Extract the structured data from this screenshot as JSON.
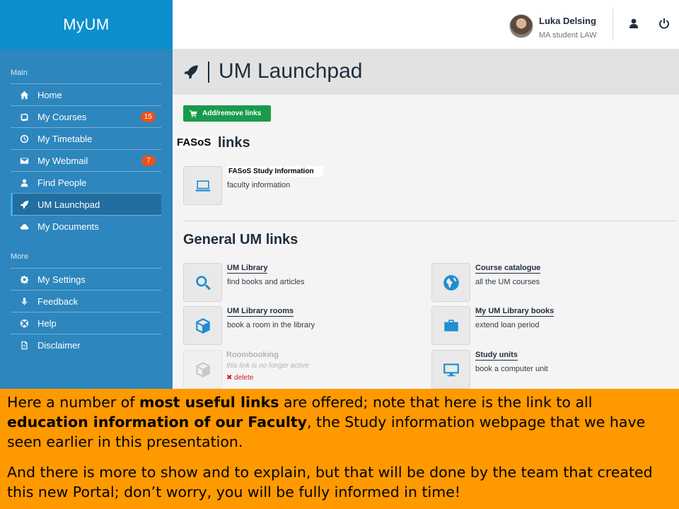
{
  "app": {
    "brand": "MyUM"
  },
  "header": {
    "user_name": "Luka Delsing",
    "user_role": "MA student LAW"
  },
  "sidebar": {
    "main_title": "Main",
    "main_items": [
      {
        "label": "Home",
        "icon": "home-icon"
      },
      {
        "label": "My Courses",
        "icon": "book-icon",
        "badge": "15"
      },
      {
        "label": "My Timetable",
        "icon": "clock-icon"
      },
      {
        "label": "My Webmail",
        "icon": "envelope-icon",
        "badge": "7"
      },
      {
        "label": "Find People",
        "icon": "person-icon"
      },
      {
        "label": "UM Launchpad",
        "icon": "rocket-icon",
        "active": true
      },
      {
        "label": "My Documents",
        "icon": "cloud-icon"
      }
    ],
    "more_title": "More",
    "more_items": [
      {
        "label": "My Settings",
        "icon": "gear-icon"
      },
      {
        "label": "Feedback",
        "icon": "microphone-icon"
      },
      {
        "label": "Help",
        "icon": "lifebuoy-icon"
      },
      {
        "label": "Disclaimer",
        "icon": "document-icon"
      }
    ]
  },
  "page": {
    "title": "UM Launchpad",
    "add_button": "Add/remove links",
    "fasos_tag": "FASoS",
    "fasos_heading": "links",
    "fasos_link": {
      "title": "FASoS Study Information",
      "desc": "faculty information",
      "icon": "laptop-icon"
    },
    "general_heading": "General UM links",
    "general_links": [
      {
        "title": "UM Library",
        "desc": "find books and articles",
        "icon": "search-icon"
      },
      {
        "title": "Course catalogue",
        "desc": "all the UM courses",
        "icon": "globe-icon"
      },
      {
        "title": "UM Library rooms",
        "desc": "book a room in the library",
        "icon": "cube-icon"
      },
      {
        "title": "My UM Library books",
        "desc": "extend loan period",
        "icon": "briefcase-icon"
      },
      {
        "title": "Roombooking",
        "desc": "this link is no longer active",
        "icon": "cube-icon",
        "disabled": true,
        "delete": "✖ delete"
      },
      {
        "title": "Study units",
        "desc": "book a computer unit",
        "icon": "monitor-icon"
      }
    ]
  },
  "notes": {
    "p1": [
      {
        "text": "Here a number of "
      },
      {
        "text": "most useful links",
        "bold": true
      },
      {
        "text": " are offered; note that here is the link to all "
      },
      {
        "text": "education information of our Faculty",
        "bold": true
      },
      {
        "text": ", the Study information webpage that we have seen earlier in this presentation."
      }
    ],
    "p2": "And there is more to show and to explain, but that will be done by the team that created this new Portal; don’t worry, you will be fully informed in time!"
  },
  "colors": {
    "sidebar": "#2d86bd",
    "brand_bar": "#0d8ecd",
    "accent_green": "#1a9b4b",
    "badge": "#e8531c",
    "notes_bg": "#ff9900",
    "icon_blue": "#1f8fd0"
  }
}
